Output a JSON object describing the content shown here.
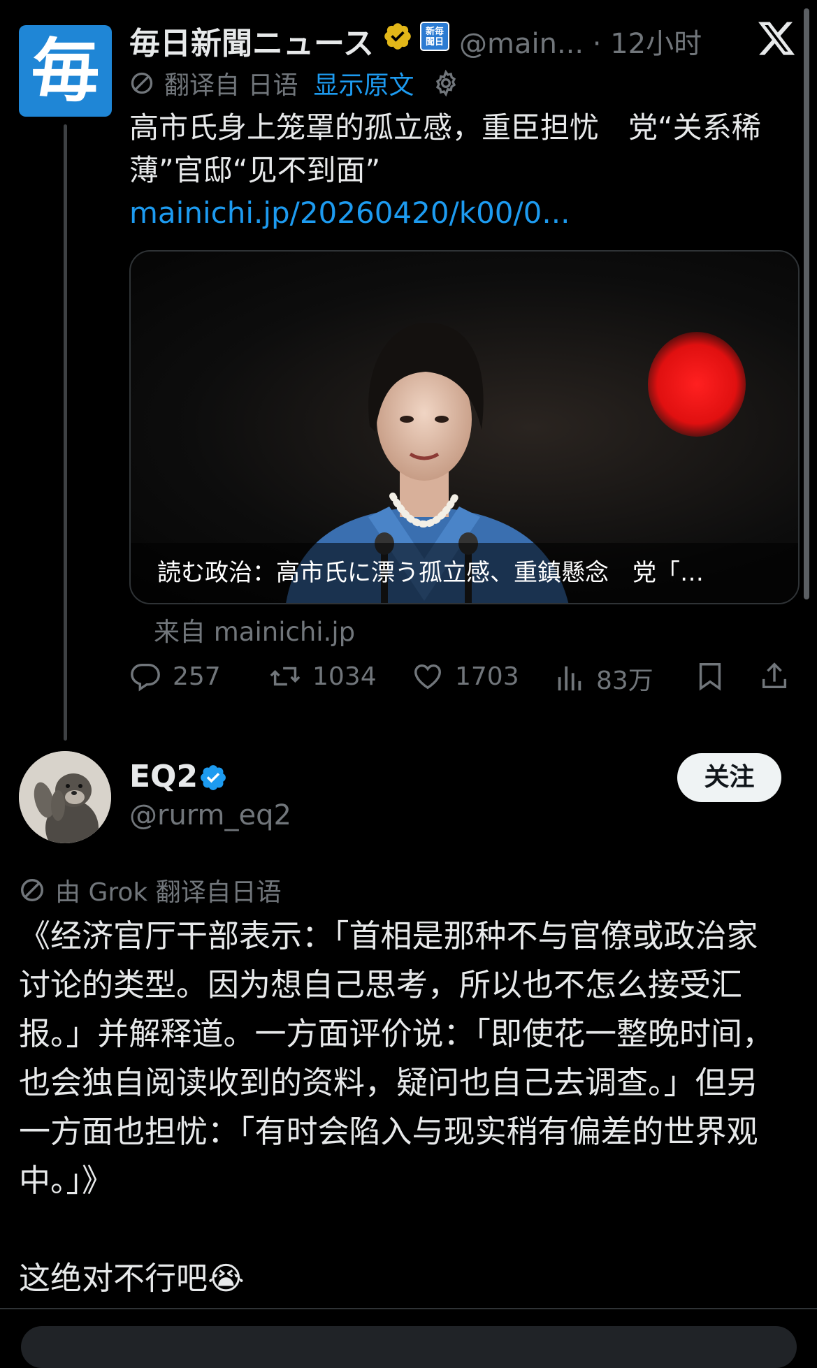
{
  "post1": {
    "avatar_glyph": "毎",
    "author_name": "毎日新聞ニュース",
    "affiliate_badge_text": "新毎聞日",
    "handle_time": "@main... · 12小时",
    "translated_from": "翻译自 日语",
    "show_original": "显示原文",
    "text": "高市氏身上笼罩的孤立感，重臣担忧　党“关系稀薄”官邸“见不到面”",
    "link": "mainichi.jp/20260420/k00/0...",
    "media_caption": "読む政治：高市氏に漂う孤立感、重鎮懸念　党「…",
    "source": "来自 mainichi.jp",
    "stats": {
      "replies": "257",
      "reposts": "1034",
      "likes": "1703",
      "views": "83万"
    },
    "icons": [
      "mainichi-logo",
      "verified-gold-icon",
      "affiliate-badge-icon",
      "x-logo-icon",
      "translate-icon",
      "gear-icon",
      "reply-icon",
      "repost-icon",
      "like-icon",
      "views-icon",
      "bookmark-icon",
      "share-icon"
    ]
  },
  "post2": {
    "author_name": "EQ2",
    "handle": "@rurm_eq2",
    "follow_label": "关注",
    "grok_translation": "由 Grok 翻译自日语",
    "text": "《经济官厅干部表示：「首相是那种不与官僚或政治家讨论的类型。因为想自己思考，所以也不怎么接受汇报。」并解释道。一方面评价说：「即使花一整晚时间，也会独自阅读收到的资料，疑问也自己去调查。」但另一方面也担忧：「有时会陷入与现实稍有偏差的世界观中。」》",
    "tail": "这绝对不行吧😭",
    "icons": [
      "otter-avatar",
      "verified-blue-icon",
      "translate-icon"
    ]
  },
  "colors": {
    "accent": "#1d9bf0",
    "muted": "#71767b",
    "text": "#e7e9ea",
    "gold": "#e2b719"
  }
}
